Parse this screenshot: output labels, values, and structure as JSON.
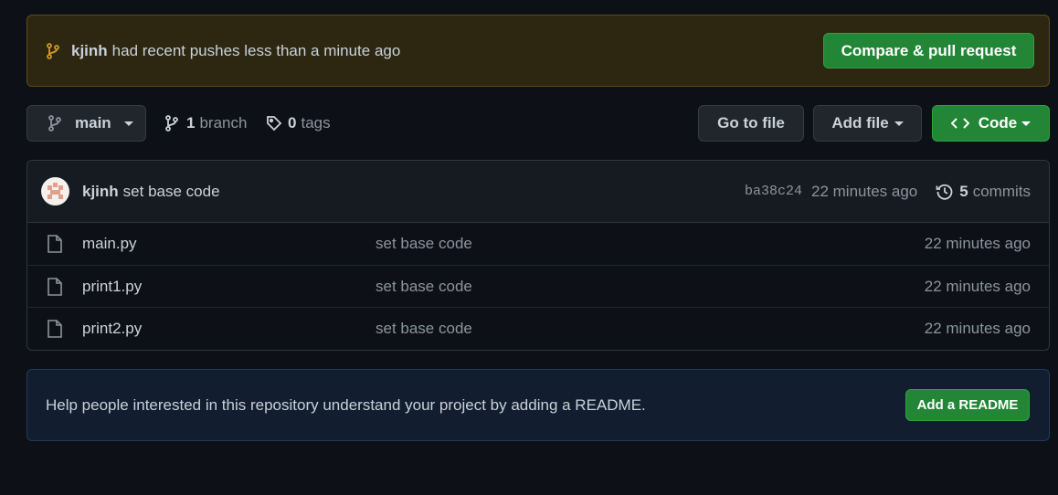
{
  "push_banner": {
    "user": "kjinh",
    "message": "had recent pushes less than a minute ago",
    "compare_button": "Compare & pull request"
  },
  "toolbar": {
    "branch": "main",
    "branch_count": "1",
    "branch_label": "branch",
    "tag_count": "0",
    "tag_label": "tags",
    "go_to_file": "Go to file",
    "add_file": "Add file",
    "code": "Code"
  },
  "latest_commit": {
    "author": "kjinh",
    "message": "set base code",
    "sha": "ba38c24",
    "time": "22 minutes ago",
    "commit_count": "5",
    "commit_label": "commits"
  },
  "files": [
    {
      "name": "main.py",
      "message": "set base code",
      "time": "22 minutes ago"
    },
    {
      "name": "print1.py",
      "message": "set base code",
      "time": "22 minutes ago"
    },
    {
      "name": "print2.py",
      "message": "set base code",
      "time": "22 minutes ago"
    }
  ],
  "readme_banner": {
    "text": "Help people interested in this repository understand your project by adding a README.",
    "button": "Add a README"
  },
  "colors": {
    "background": "#0d1117",
    "primary_button": "#238636",
    "push_banner_bg": "#2d2712",
    "readme_banner_bg": "#121d2f"
  }
}
